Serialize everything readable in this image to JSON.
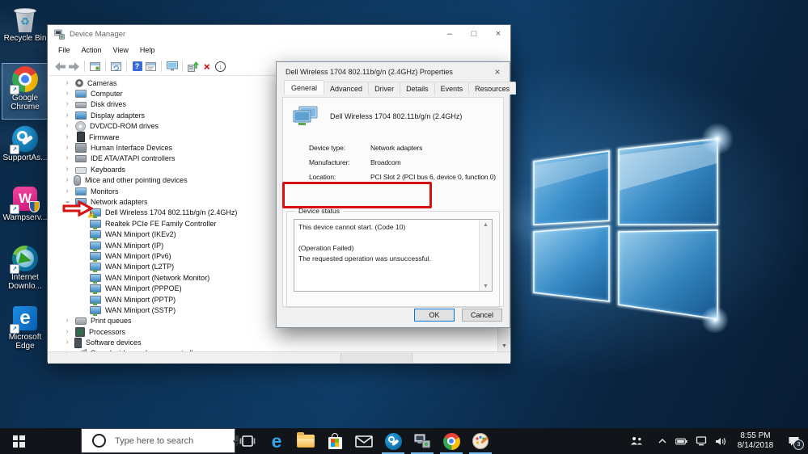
{
  "desktop_icons": [
    {
      "id": "recycle-bin",
      "label": "Recycle Bin",
      "selected": false,
      "shortcut": false
    },
    {
      "id": "google-chrome",
      "label": "Google\nChrome",
      "selected": true,
      "shortcut": true
    },
    {
      "id": "supportassist",
      "label": "SupportAs...",
      "selected": false,
      "shortcut": true
    },
    {
      "id": "wampserver",
      "label": "Wampserv...",
      "selected": false,
      "shortcut": true
    },
    {
      "id": "internet-download-manager",
      "label": "Internet\nDownlo...",
      "selected": false,
      "shortcut": true
    },
    {
      "id": "microsoft-edge",
      "label": "Microsoft\nEdge",
      "selected": false,
      "shortcut": true
    }
  ],
  "device_manager": {
    "title": "Device Manager",
    "window_controls": {
      "minimize": "–",
      "maximize": "□",
      "close": "×"
    },
    "menu": [
      "File",
      "Action",
      "View",
      "Help"
    ],
    "toolbar": [
      "back",
      "forward",
      "sep",
      "console",
      "sep",
      "refresh",
      "sep",
      "help",
      "properties",
      "sep",
      "scan",
      "sep",
      "update-driver",
      "uninstall",
      "disable"
    ],
    "tree": [
      {
        "label": "Cameras",
        "level": 0,
        "expand": "collapsed",
        "icon": "camera"
      },
      {
        "label": "Computer",
        "level": 0,
        "expand": "collapsed",
        "icon": "computer"
      },
      {
        "label": "Disk drives",
        "level": 0,
        "expand": "collapsed",
        "icon": "disk"
      },
      {
        "label": "Display adapters",
        "level": 0,
        "expand": "collapsed",
        "icon": "display"
      },
      {
        "label": "DVD/CD-ROM drives",
        "level": 0,
        "expand": "collapsed",
        "icon": "dvd"
      },
      {
        "label": "Firmware",
        "level": 0,
        "expand": "collapsed",
        "icon": "firmware"
      },
      {
        "label": "Human Interface Devices",
        "level": 0,
        "expand": "collapsed",
        "icon": "hid"
      },
      {
        "label": "IDE ATA/ATAPI controllers",
        "level": 0,
        "expand": "collapsed",
        "icon": "ide"
      },
      {
        "label": "Keyboards",
        "level": 0,
        "expand": "collapsed",
        "icon": "keyboard"
      },
      {
        "label": "Mice and other pointing devices",
        "level": 0,
        "expand": "collapsed",
        "icon": "mouse"
      },
      {
        "label": "Monitors",
        "level": 0,
        "expand": "collapsed",
        "icon": "monitor"
      },
      {
        "label": "Network adapters",
        "level": 0,
        "expand": "expanded",
        "icon": "network"
      },
      {
        "label": "Dell Wireless 1704 802.11b/g/n (2.4GHz)",
        "level": 1,
        "icon": "network",
        "warning": true
      },
      {
        "label": "Realtek PCIe FE Family Controller",
        "level": 1,
        "icon": "network"
      },
      {
        "label": "WAN Miniport (IKEv2)",
        "level": 1,
        "icon": "network"
      },
      {
        "label": "WAN Miniport (IP)",
        "level": 1,
        "icon": "network"
      },
      {
        "label": "WAN Miniport (IPv6)",
        "level": 1,
        "icon": "network"
      },
      {
        "label": "WAN Miniport (L2TP)",
        "level": 1,
        "icon": "network"
      },
      {
        "label": "WAN Miniport (Network Monitor)",
        "level": 1,
        "icon": "network"
      },
      {
        "label": "WAN Miniport (PPPOE)",
        "level": 1,
        "icon": "network"
      },
      {
        "label": "WAN Miniport (PPTP)",
        "level": 1,
        "icon": "network"
      },
      {
        "label": "WAN Miniport (SSTP)",
        "level": 1,
        "icon": "network"
      },
      {
        "label": "Print queues",
        "level": 0,
        "expand": "collapsed",
        "icon": "printer"
      },
      {
        "label": "Processors",
        "level": 0,
        "expand": "collapsed",
        "icon": "processor"
      },
      {
        "label": "Software devices",
        "level": 0,
        "expand": "collapsed",
        "icon": "software"
      },
      {
        "label": "Sound, video and game controllers",
        "level": 0,
        "expand": "collapsed",
        "icon": "sound"
      }
    ]
  },
  "properties_dialog": {
    "title": "Dell Wireless 1704 802.11b/g/n (2.4GHz) Properties",
    "close": "×",
    "tabs": [
      "General",
      "Advanced",
      "Driver",
      "Details",
      "Events",
      "Resources"
    ],
    "active_tab": "General",
    "device_name": "Dell Wireless 1704 802.11b/g/n (2.4GHz)",
    "fields": [
      {
        "label": "Device type:",
        "value": "Network adapters"
      },
      {
        "label": "Manufacturer:",
        "value": "Broadcom"
      },
      {
        "label": "Location:",
        "value": "PCI Slot 2 (PCI bus 6, device 0, function 0)"
      }
    ],
    "group_label": "Device status",
    "status_lines": [
      "This device cannot start. (Code 10)",
      "",
      "(Operation Failed)",
      "The requested operation was unsuccessful."
    ],
    "buttons": {
      "ok": "OK",
      "cancel": "Cancel"
    }
  },
  "annotations": {
    "highlight_color": "#d61111"
  },
  "taskbar": {
    "search_placeholder": "Type here to search",
    "apps": [
      {
        "id": "task-view",
        "running": false
      },
      {
        "id": "edge",
        "running": false
      },
      {
        "id": "file-explorer",
        "running": false
      },
      {
        "id": "store",
        "running": false
      },
      {
        "id": "mail",
        "running": false
      },
      {
        "id": "supportassist",
        "running": true
      },
      {
        "id": "device-manager",
        "running": true
      },
      {
        "id": "chrome",
        "running": true
      },
      {
        "id": "paint",
        "running": true
      }
    ],
    "tray": {
      "icons": [
        "people",
        "chevron-up",
        "battery",
        "network",
        "volume"
      ],
      "time": "8:55 PM",
      "date": "8/14/2018",
      "notification_count": "3"
    }
  }
}
